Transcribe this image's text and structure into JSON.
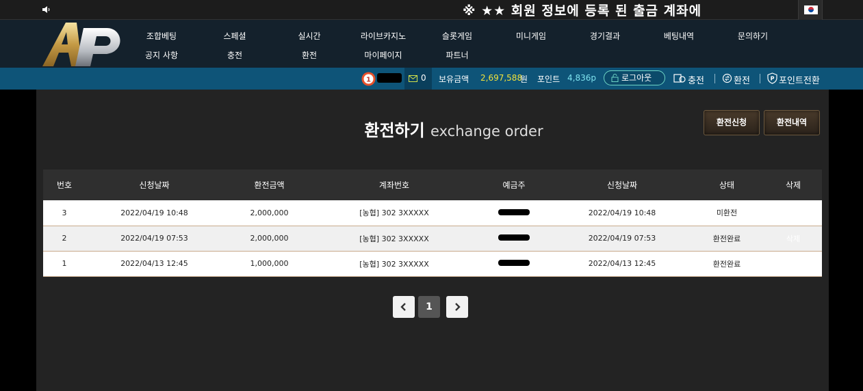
{
  "notice": {
    "text": "※ ★★ 회원 정보에 등록 된 출금 계좌에"
  },
  "nav": {
    "row1": [
      "조합베팅",
      "스페셜",
      "실시간",
      "라이브카지노",
      "슬롯게임",
      "미니게임",
      "경기결과",
      "베팅내역",
      "문의하기"
    ],
    "row2": [
      "공지 사항",
      "충전",
      "환전",
      "마이페이지",
      "파트너"
    ]
  },
  "userbar": {
    "level_badge": "1",
    "message_count": "0",
    "balance_label": "보유금액",
    "balance_value": "2,697,588",
    "balance_unit": "원",
    "point_label": "포인트",
    "point_value": "4,836p",
    "logout_label": "로그아웃",
    "charge_label": "충전",
    "exchange_label": "환전",
    "point_convert_label": "포인트전환"
  },
  "page": {
    "title": "환전하기",
    "subtitle": "exchange order",
    "btn_request": "환전신청",
    "btn_history": "환전내역"
  },
  "table": {
    "headers": [
      "번호",
      "신청날짜",
      "환전금액",
      "계좌번호",
      "예금주",
      "신청날짜",
      "상태",
      "삭제"
    ],
    "rows": [
      {
        "no": "3",
        "date": "2022/04/19 10:48",
        "amount": "2,000,000",
        "account": "[농협] 302 3XXXXX",
        "date2": "2022/04/19 10:48",
        "status": "미환전",
        "delete": ""
      },
      {
        "no": "2",
        "date": "2022/04/19 07:53",
        "amount": "2,000,000",
        "account": "[농협] 302 3XXXXX",
        "date2": "2022/04/19 07:53",
        "status": "환전완료",
        "delete": "삭제"
      },
      {
        "no": "1",
        "date": "2022/04/13 12:45",
        "amount": "1,000,000",
        "account": "[농협] 302 3XXXXX",
        "date2": "2022/04/13 12:45",
        "status": "환전완료",
        "delete": ""
      }
    ]
  },
  "pagination": {
    "current": "1"
  },
  "colors": {
    "nav_bg": "#14212c",
    "userbar_bg": "#0e5478",
    "balance": "#f2e23a",
    "point": "#7fe3ef",
    "panel": "#232323"
  }
}
